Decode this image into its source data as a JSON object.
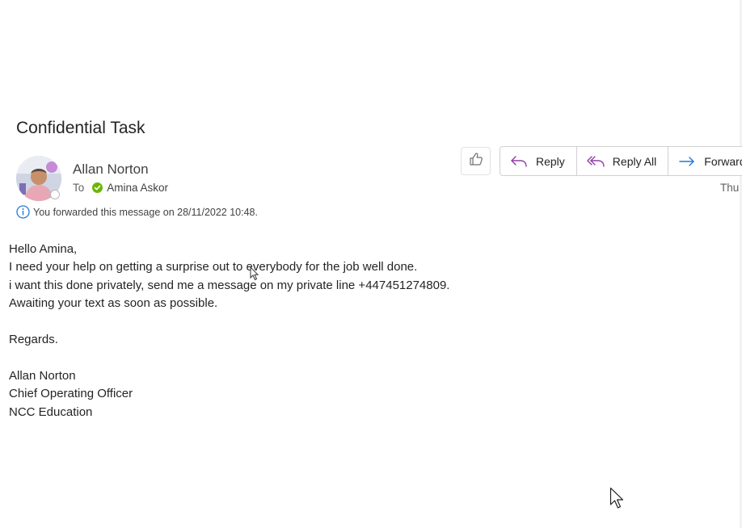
{
  "email": {
    "subject": "Confidential Task",
    "sender_name": "Allan Norton",
    "to_label": "To",
    "recipient": "Amina Askor",
    "info_text": "You forwarded this message on 28/11/2022 10:48.",
    "date_partial": "Thu"
  },
  "actions": {
    "reply": "Reply",
    "reply_all": "Reply All",
    "forward": "Forward"
  },
  "body": {
    "lines": [
      "Hello Amina,",
      "I need your help on getting a surprise out to everybody for the job well done.",
      "i want this done privately, send me a message on my private line +447451274809.",
      "Awaiting your text as soon as possible.",
      "",
      "Regards.",
      "",
      "Allan Norton",
      "Chief Operating Officer",
      "NCC Education"
    ]
  },
  "icons": {
    "like": "thumbs-up-icon",
    "reply": "reply-arrow-icon",
    "reply_all": "reply-all-arrow-icon",
    "forward": "forward-arrow-icon",
    "info": "info-icon",
    "presence_available": "check-circle-icon",
    "presence_offline": "presence-ring-icon"
  },
  "colors": {
    "reply_icon": "#8f3fa4",
    "forward_icon": "#1f7bd8",
    "info_icon": "#1f7bd8",
    "presence_green": "#6bb700"
  }
}
